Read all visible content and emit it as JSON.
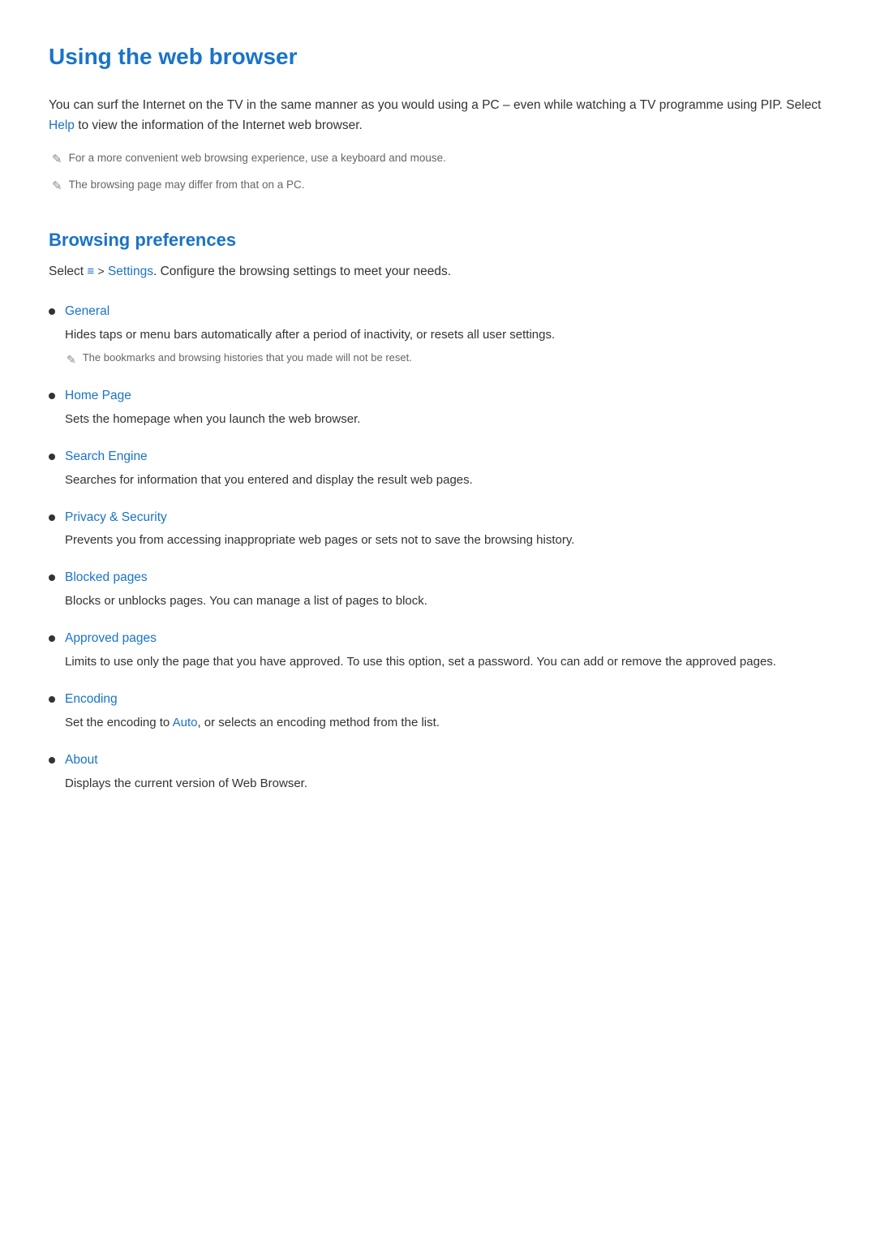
{
  "page": {
    "title": "Using the web browser",
    "intro": {
      "text_before_link": "You can surf the Internet on the TV in the same manner as you would using a PC – even while watching a TV programme using PIP. Select ",
      "link_text": "Help",
      "text_after_link": " to view the information of the Internet web browser."
    },
    "notes": [
      "For a more convenient web browsing experience, use a keyboard and mouse.",
      "The browsing page may differ from that on a PC."
    ]
  },
  "browsing_preferences": {
    "section_title": "Browsing preferences",
    "intro": {
      "text_before_link": "Select ",
      "menu_symbol": "≡",
      "arrow": ">",
      "link_text": "Settings",
      "text_after_link": ". Configure the browsing settings to meet your needs."
    },
    "items": [
      {
        "label": "General",
        "description": "Hides taps or menu bars automatically after a period of inactivity, or resets all user settings.",
        "note": "The bookmarks and browsing histories that you made will not be reset."
      },
      {
        "label": "Home Page",
        "description": "Sets the homepage when you launch the web browser.",
        "note": null
      },
      {
        "label": "Search Engine",
        "description": "Searches for information that you entered and display the result web pages.",
        "note": null
      },
      {
        "label": "Privacy & Security",
        "description": "Prevents you from accessing inappropriate web pages or sets not to save the browsing history.",
        "note": null
      },
      {
        "label": "Blocked pages",
        "description": "Blocks or unblocks pages. You can manage a list of pages to block.",
        "note": null
      },
      {
        "label": "Approved pages",
        "description": "Limits to use only the page that you have approved. To use this option, set a password. You can add or remove the approved pages.",
        "note": null
      },
      {
        "label": "Encoding",
        "description_before_link": "Set the encoding to ",
        "description_link": "Auto",
        "description_after_link": ", or selects an encoding method from the list.",
        "has_inline_link": true,
        "note": null
      },
      {
        "label": "About",
        "description": "Displays the current version of Web Browser.",
        "note": null
      }
    ]
  },
  "icons": {
    "pencil": "✎"
  }
}
